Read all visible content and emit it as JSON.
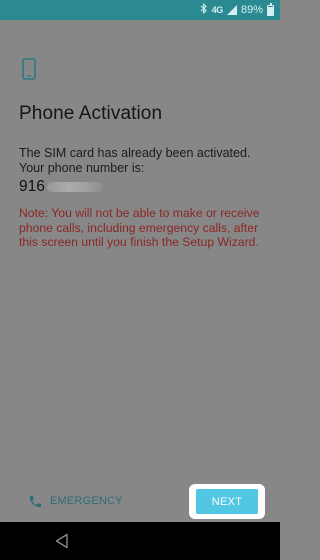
{
  "status_bar": {
    "network_label": "4G",
    "battery_text": "89%",
    "battery_level": 0.89,
    "icons": [
      "bluetooth-icon",
      "signal-icon",
      "battery-icon"
    ]
  },
  "screen": {
    "icon": "phone-icon",
    "title": "Phone Activation",
    "info_text": "The SIM card has already been activated. Your phone number is:",
    "phone_number_prefix": "916",
    "note": "Note: You will not be able to make or receive phone calls, including emergency calls, after this screen until you finish the Setup Wizard."
  },
  "footer": {
    "emergency_label": "EMERGENCY",
    "next_label": "NEXT"
  },
  "nav_bar": {
    "icons": [
      "back-icon"
    ]
  },
  "colors": {
    "status_bar": "#2b8a91",
    "scrim_background": "#878787",
    "note_text": "#8b2626",
    "accent_button": "#52c7e4",
    "emergency_text": "#2a6d74"
  }
}
